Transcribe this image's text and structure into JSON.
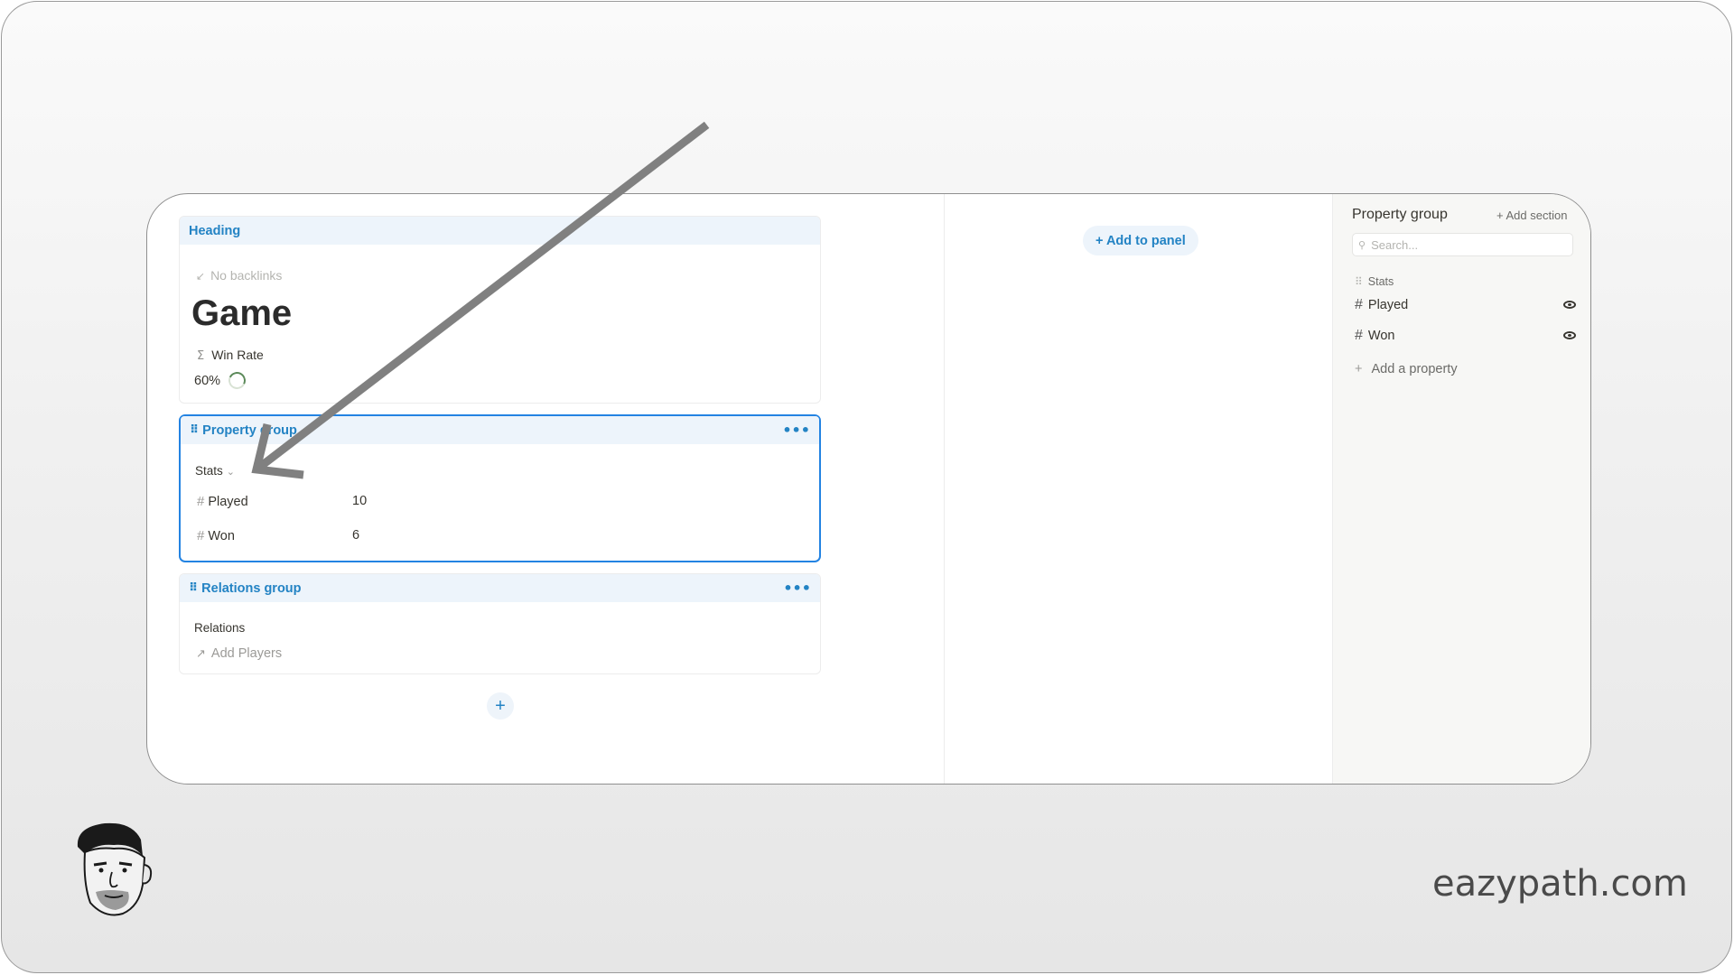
{
  "main": {
    "heading_card": {
      "header": "Heading",
      "backlinks_icon": "backlink-arrow-icon",
      "backlinks": "No backlinks",
      "title": "Game",
      "formula_icon": "sigma-icon",
      "winrate_label": "Win Rate",
      "winrate_value": "60%",
      "winrate_fraction": 0.6
    },
    "property_group": {
      "header": "Property group",
      "menu": "•••",
      "section": "Stats",
      "rows": [
        {
          "name": "Played",
          "value": "10"
        },
        {
          "name": "Won",
          "value": "6"
        }
      ]
    },
    "relations_group": {
      "header": "Relations group",
      "menu": "•••",
      "title": "Relations",
      "add_label": "Add Players"
    },
    "add_block": "+"
  },
  "panel": {
    "add_to_panel": "+ Add to panel"
  },
  "sidebar": {
    "title": "Property group",
    "add_section": "+ Add section",
    "search_placeholder": "Search...",
    "section": "Stats",
    "items": [
      {
        "label": "Played",
        "visible": true
      },
      {
        "label": "Won",
        "visible": true
      }
    ],
    "add_property": "Add a property"
  },
  "branding": {
    "site": "eazypath.com"
  },
  "colors": {
    "accent": "#2383c4",
    "selection_border": "#2383e2",
    "header_bg": "#edf4fb",
    "annotation_arrow": "#808080"
  }
}
